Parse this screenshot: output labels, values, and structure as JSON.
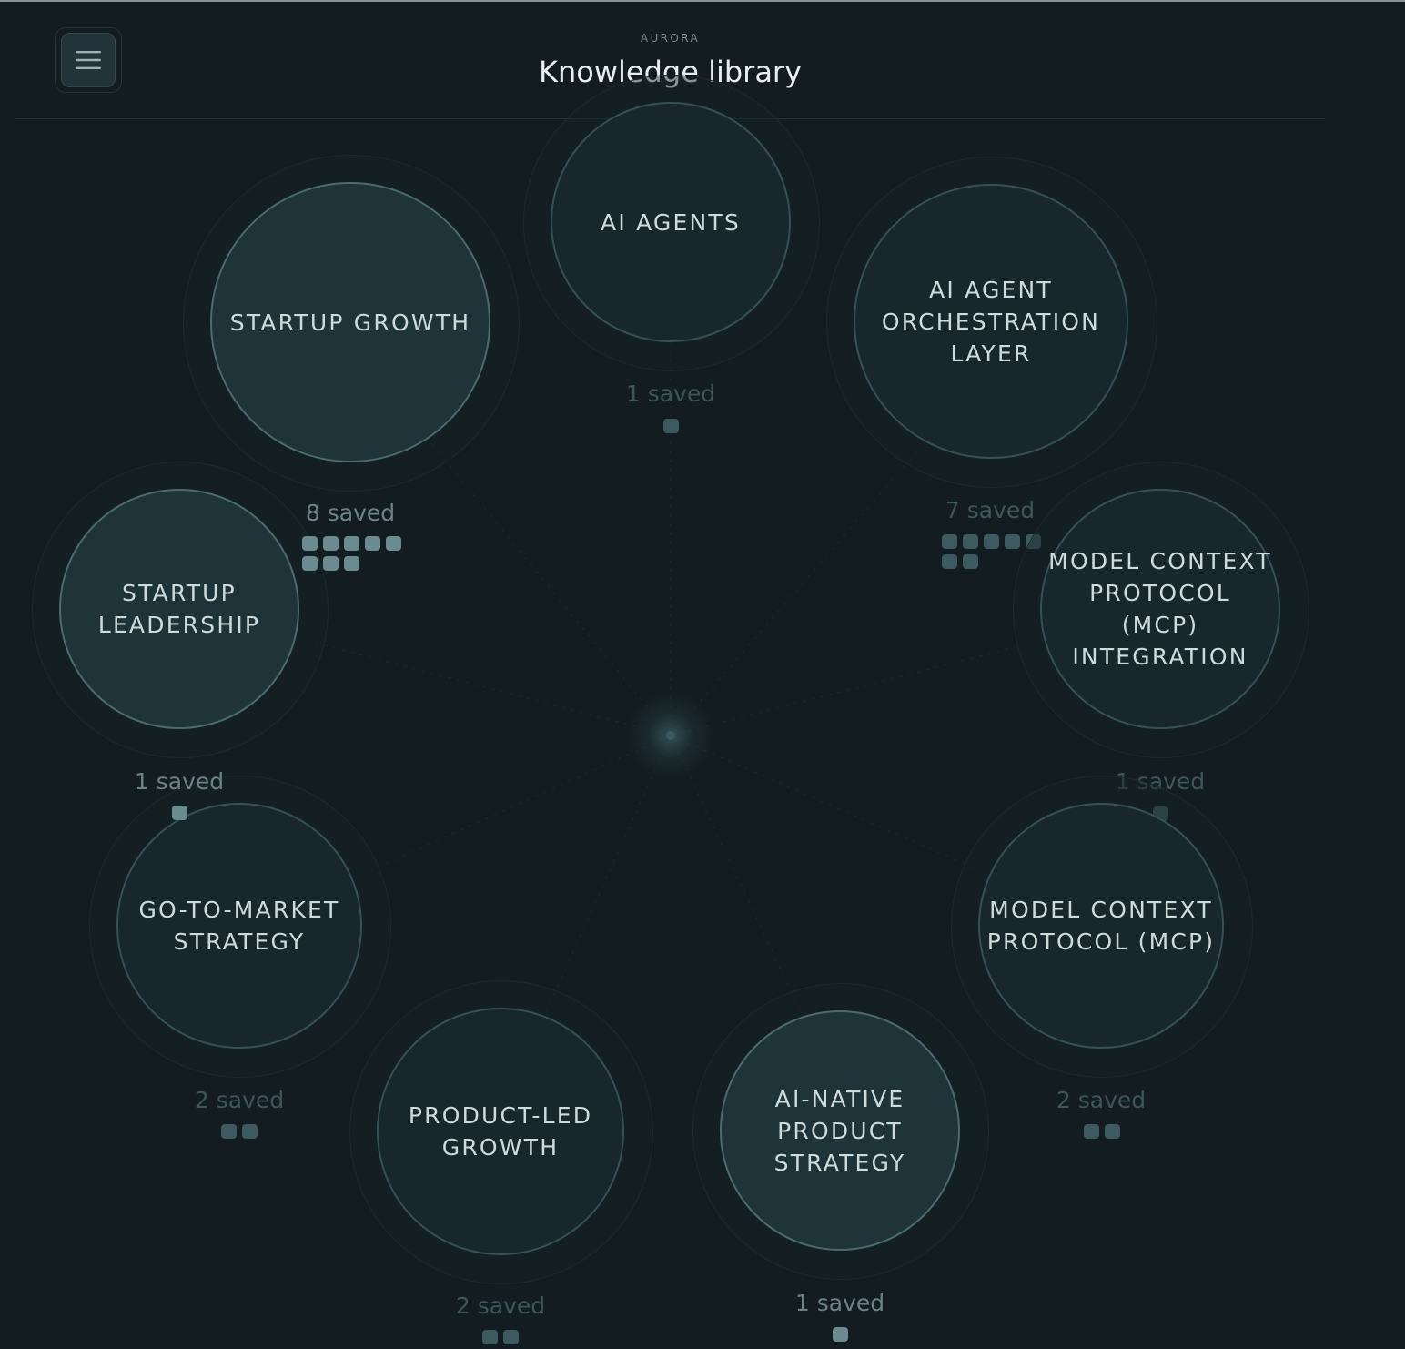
{
  "app": {
    "brand": "AURORA",
    "title": "Knowledge library"
  },
  "menu": {
    "icon": "hamburger-menu-icon"
  },
  "colors": {
    "background": "#131c20",
    "node_fill": "#18272c",
    "node_fill_active": "#1f3438",
    "node_border": "#365057",
    "label": "#cfdadb",
    "count": "#6d8287",
    "pip": "#6a8c91"
  },
  "topics": [
    {
      "id": "ai-agents",
      "label": "AI AGENTS",
      "count_label": "1 saved",
      "saved": 1,
      "active": false
    },
    {
      "id": "ai-agent-orchestration-layer",
      "label": "AI AGENT ORCHESTRATION LAYER",
      "count_label": "7 saved",
      "saved": 7,
      "active": false
    },
    {
      "id": "model-context-protocol-mcp-integration",
      "label": "MODEL CONTEXT PROTOCOL (MCP) INTEGRATION",
      "count_label": "1 saved",
      "saved": 1,
      "active": false
    },
    {
      "id": "model-context-protocol-mcp",
      "label": "MODEL CONTEXT PROTOCOL (MCP)",
      "count_label": "2 saved",
      "saved": 2,
      "active": false
    },
    {
      "id": "ai-native-product-strategy",
      "label": "AI-NATIVE PRODUCT STRATEGY",
      "count_label": "1 saved",
      "saved": 1,
      "active": true
    },
    {
      "id": "product-led-growth",
      "label": "PRODUCT-LED GROWTH",
      "count_label": "2 saved",
      "saved": 2,
      "active": false
    },
    {
      "id": "go-to-market-strategy",
      "label": "GO-TO-MARKET STRATEGY",
      "count_label": "2 saved",
      "saved": 2,
      "active": false
    },
    {
      "id": "startup-leadership",
      "label": "STARTUP LEADERSHIP",
      "count_label": "1 saved",
      "saved": 1,
      "active": true
    },
    {
      "id": "startup-growth",
      "label": "STARTUP GROWTH",
      "count_label": "8 saved",
      "saved": 8,
      "active": true
    }
  ]
}
